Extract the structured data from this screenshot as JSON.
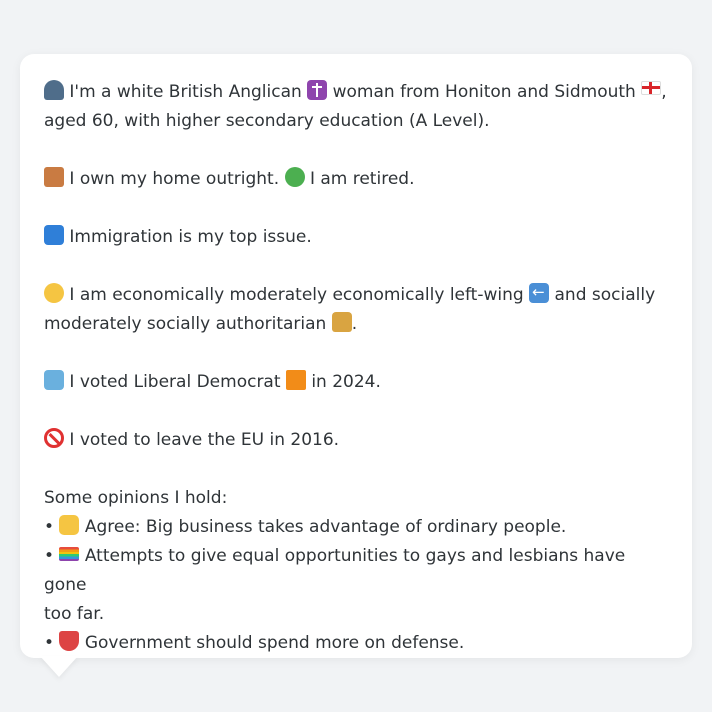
{
  "bio": {
    "line1": "I'm a white British Anglican",
    "line1b": "woman from Honiton and Sidmouth",
    "line1c": ",",
    "line2": "aged 60, with higher secondary education (A Level).",
    "home_a": "I own my home outright.",
    "home_b": "I am retired.",
    "issue": "Immigration is my top issue.",
    "econ_a": "I am economically moderately economically left-wing",
    "econ_b": "and socially",
    "econ_c": "moderately socially authoritarian",
    "econ_d": ".",
    "vote_a": "I voted Liberal Democrat",
    "vote_b": "in 2024.",
    "eu": "I voted to leave the EU in 2016."
  },
  "opinions": {
    "heading": "Some opinions I hold:",
    "items": [
      {
        "bullet": "•",
        "text": "Agree: Big business takes advantage of ordinary people."
      },
      {
        "bullet": "•",
        "text": "Attempts to give equal opportunities to gays and lesbians have gone"
      },
      {
        "bullet": "",
        "text": "too far."
      },
      {
        "bullet": "•",
        "text": "Government should spend more on defense."
      }
    ]
  },
  "icons": {
    "person": "person-icon",
    "cross": "latin-cross-icon",
    "flag": "england-flag-icon",
    "house": "house-icon",
    "palm": "palm-tree-icon",
    "passport": "passport-control-icon",
    "think": "thinking-face-icon",
    "left_arrow": "left-arrow-icon",
    "lock": "lock-icon",
    "ballot": "ballot-box-icon",
    "party": "orange-square-icon",
    "no": "prohibited-icon",
    "thumbs": "thumbs-up-icon",
    "rainbow": "rainbow-flag-icon",
    "shield": "shield-icon"
  },
  "colors": {
    "background": "#f1f3f5",
    "card": "#ffffff",
    "text": "#2f3438"
  }
}
